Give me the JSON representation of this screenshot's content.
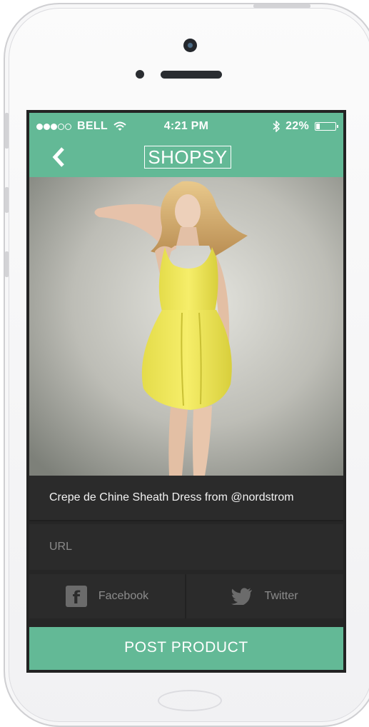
{
  "colors": {
    "accent": "#63b996",
    "screen_background": "#262626",
    "field_background": "#2b2b2b"
  },
  "status_bar": {
    "carrier": "BELL",
    "time": "4:21 PM",
    "battery": "22%",
    "battery_level": 0.22,
    "signal_bars_filled": 3,
    "signal_bars_total": 5,
    "icons": [
      "wifi-icon",
      "bluetooth-icon",
      "battery-icon"
    ]
  },
  "header": {
    "logo": "SHOPSY",
    "back_icon": "chevron-left-icon"
  },
  "product": {
    "image_alt": "product-photo",
    "title": "Crepe de Chine Sheath Dress from @nordstrom"
  },
  "form": {
    "url_placeholder": "URL",
    "url_value": ""
  },
  "share": {
    "facebook_label": "Facebook",
    "facebook_icon": "facebook-icon",
    "twitter_label": "Twitter",
    "twitter_icon": "twitter-icon"
  },
  "post_button": {
    "label": "POST PRODUCT"
  }
}
